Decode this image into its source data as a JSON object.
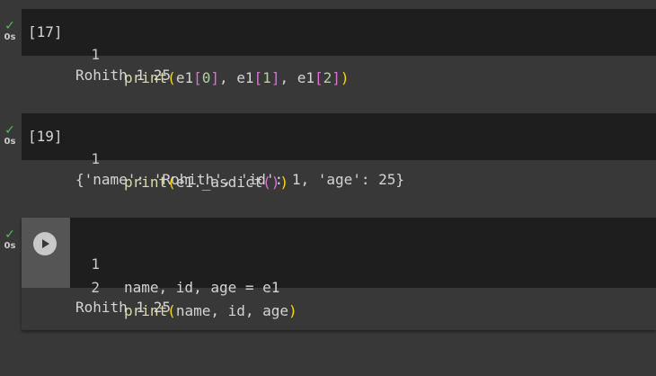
{
  "cells": [
    {
      "status_time": "0s",
      "exec_count": "[17]",
      "lines": [
        {
          "num": "1",
          "tokens": [
            {
              "t": "print",
              "c": "fn"
            },
            {
              "t": "(",
              "c": "p1"
            },
            {
              "t": "e1",
              "c": ""
            },
            {
              "t": "[",
              "c": "p2"
            },
            {
              "t": "0",
              "c": "num"
            },
            {
              "t": "]",
              "c": "p2"
            },
            {
              "t": ", e1",
              "c": ""
            },
            {
              "t": "[",
              "c": "p2"
            },
            {
              "t": "1",
              "c": "num"
            },
            {
              "t": "]",
              "c": "p2"
            },
            {
              "t": ", e1",
              "c": ""
            },
            {
              "t": "[",
              "c": "p2"
            },
            {
              "t": "2",
              "c": "num"
            },
            {
              "t": "]",
              "c": "p2"
            },
            {
              "t": ")",
              "c": "p1"
            }
          ]
        }
      ],
      "output": "Rohith 1 25"
    },
    {
      "status_time": "0s",
      "exec_count": "[19]",
      "lines": [
        {
          "num": "1",
          "tokens": [
            {
              "t": "print",
              "c": "fn"
            },
            {
              "t": "(",
              "c": "p1"
            },
            {
              "t": "e1._asdict",
              "c": ""
            },
            {
              "t": "()",
              "c": "p2"
            },
            {
              "t": ")",
              "c": "p1"
            }
          ]
        }
      ],
      "output": "{'name': 'Rohith', 'id': 1, 'age': 25}"
    },
    {
      "status_time": "0s",
      "run_icon": "play-icon",
      "lines": [
        {
          "num": "1",
          "tokens": [
            {
              "t": "name, id, age = e1",
              "c": ""
            }
          ]
        },
        {
          "num": "2",
          "tokens": [
            {
              "t": "print",
              "c": "fn"
            },
            {
              "t": "(",
              "c": "p1"
            },
            {
              "t": "name, id, age",
              "c": ""
            },
            {
              "t": ")",
              "c": "p1"
            }
          ]
        }
      ],
      "output": "Rohith 1 25"
    }
  ],
  "colors": {
    "check": "#5cb85c",
    "code_bg": "#1e1e1e",
    "page_bg": "#383838"
  }
}
